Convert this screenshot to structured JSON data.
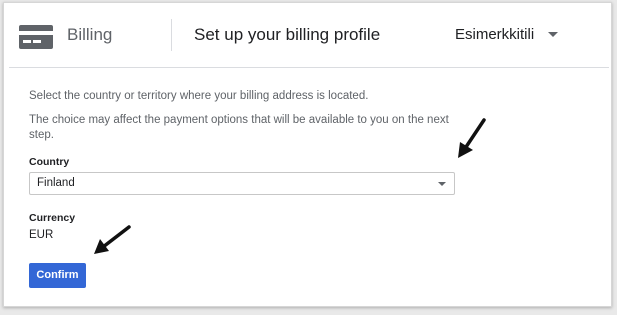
{
  "header": {
    "app_icon": "credit-card-icon",
    "app_title": "Billing",
    "page_title": "Set up your billing profile",
    "account_name": "Esimerkkitili",
    "account_icon": "chevron-down-icon"
  },
  "form": {
    "description_1": "Select the country or territory where your billing address is located.",
    "description_2": "The choice may affect the payment options that will be available to you on the next step.",
    "country_label": "Country",
    "country_value": "Finland",
    "country_icon": "dropdown-arrow-icon",
    "currency_label": "Currency",
    "currency_value": "EUR",
    "confirm_label": "Confirm"
  },
  "annotations": {
    "arrow_icon": "pointer-arrow-icon"
  },
  "colors": {
    "accent": "#3367d6",
    "text_primary": "#202124",
    "text_secondary": "#5f6368",
    "divider": "#dadce0"
  }
}
